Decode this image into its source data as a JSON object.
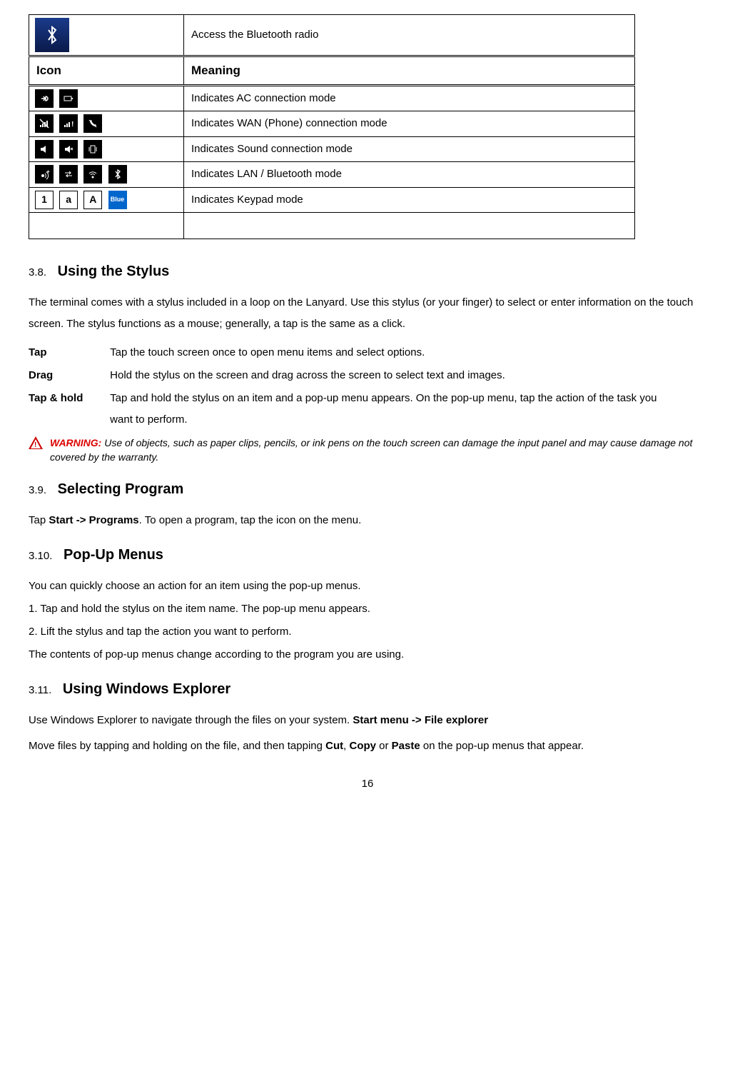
{
  "table1": {
    "row_bluetooth": "Access the Bluetooth radio",
    "header_icon": "Icon",
    "header_meaning": "Meaning",
    "row_ac": "Indicates AC connection mode",
    "row_wan": "Indicates WAN (Phone) connection mode",
    "row_sound": "Indicates Sound connection mode",
    "row_lan": "Indicates LAN / Bluetooth mode",
    "row_keypad": "Indicates Keypad mode",
    "blue_label": "Blue"
  },
  "s38": {
    "num": "3.8.",
    "title": "Using the Stylus",
    "intro": "The terminal comes with a stylus included in a loop on the Lanyard. Use this stylus (or your finger) to select or enter information on the touch screen. The stylus functions as a mouse; generally, a tap is the same as a click.",
    "tap_term": "Tap",
    "tap_desc": "Tap the touch screen once to open menu items and select options.",
    "drag_term": "Drag",
    "drag_desc": "Hold the stylus on the screen and drag across the screen to select text and images.",
    "hold_term": "Tap & hold",
    "hold_desc": "Tap and hold the stylus on an item and a pop-up menu appears. On the pop-up menu, tap the action of the task you want to perform.",
    "warn_label": "WARNING:",
    "warn_text": " Use of objects, such as paper clips, pencils, or ink pens on the touch screen can damage the input panel and may cause damage not covered by the warranty."
  },
  "s39": {
    "num": "3.9.",
    "title": "Selecting Program",
    "text_pre": "Tap ",
    "text_bold": "Start -> Programs",
    "text_post": ". To open a program, tap the icon on the menu."
  },
  "s310": {
    "num": "3.10.",
    "title": "Pop-Up Menus",
    "l1": "You can quickly choose an action for an item using the pop-up menus.",
    "l2": "1. Tap and hold the stylus on the item name. The pop-up menu appears.",
    "l3": "2. Lift the stylus and tap the action you want to perform.",
    "l4": "The contents of pop-up menus change according to the program you are using."
  },
  "s311": {
    "num": "3.11.",
    "title": "Using Windows Explorer",
    "p1_pre": "Use Windows Explorer to navigate through the files on your system. ",
    "p1_bold": "Start menu -> File explorer",
    "p2_a": "Move files by tapping and holding on the file, and then tapping ",
    "p2_cut": "Cut",
    "p2_b": ", ",
    "p2_copy": "Copy",
    "p2_c": " or ",
    "p2_paste": "Paste",
    "p2_d": " on the pop-up menus that appear."
  },
  "page": "16"
}
